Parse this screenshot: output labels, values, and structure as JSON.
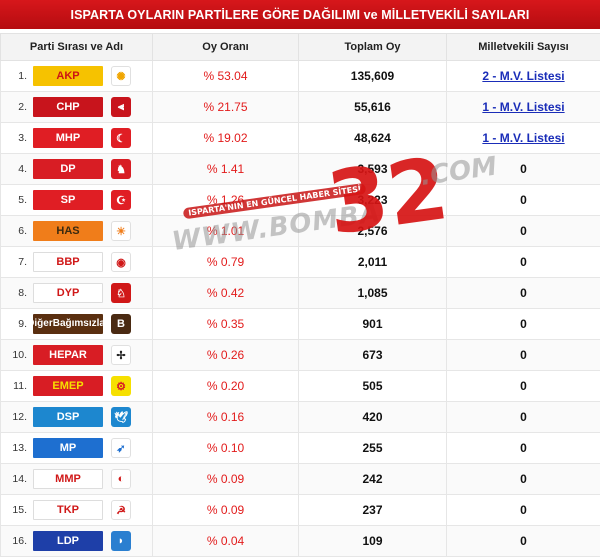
{
  "title": "ISPARTA OYLARIN PARTİLERE GÖRE DAĞILIMI ve MİLLETVEKİLİ SAYILARI",
  "headers": {
    "party": "Parti Sırası ve Adı",
    "rate": "Oy Oranı",
    "total": "Toplam Oy",
    "mv": "Milletvekili Sayısı"
  },
  "watermark": {
    "site": "WWW.BOMBA",
    "number": "32",
    "com": ".COM",
    "tag": "ISPARTA'NIN EN GÜNCEL HABER SİTESİ"
  },
  "rows": [
    {
      "rank": "1.",
      "party": "AKP",
      "rate": "% 53.04",
      "total": "135,609",
      "mv": "2 - M.V. Listesi",
      "mv_link": true,
      "box_color": "#f6c200",
      "text_color": "#cc1414",
      "logo_icon": "lightbulb-icon",
      "logo_glyph": "✺",
      "logo_color": "#f0a500",
      "logo_bg": "#ffffff"
    },
    {
      "rank": "2.",
      "party": "CHP",
      "rate": "% 21.75",
      "total": "55,616",
      "mv": "1 - M.V. Listesi",
      "mv_link": true,
      "box_color": "#c8141c",
      "text_color": "#ffffff",
      "logo_icon": "six-arrows-icon",
      "logo_glyph": "⫷",
      "logo_color": "#ffffff",
      "logo_bg": "#c8141c"
    },
    {
      "rank": "3.",
      "party": "MHP",
      "rate": "% 19.02",
      "total": "48,624",
      "mv": "1 - M.V. Listesi",
      "mv_link": true,
      "box_color": "#e01e24",
      "text_color": "#ffffff",
      "logo_icon": "three-crescents-icon",
      "logo_glyph": "☾",
      "logo_color": "#ffffff",
      "logo_bg": "#e01e24"
    },
    {
      "rank": "4.",
      "party": "DP",
      "rate": "% 1.41",
      "total": "3,593",
      "mv": "0",
      "mv_link": false,
      "box_color": "#d81d24",
      "text_color": "#ffffff",
      "logo_icon": "horse-icon",
      "logo_glyph": "♞",
      "logo_color": "#ffffff",
      "logo_bg": "#d81d24"
    },
    {
      "rank": "5.",
      "party": "SP",
      "rate": "% 1.26",
      "total": "3,223",
      "mv": "0",
      "mv_link": false,
      "box_color": "#e01e24",
      "text_color": "#ffffff",
      "logo_icon": "crescent-star-icon",
      "logo_glyph": "☪",
      "logo_color": "#ffffff",
      "logo_bg": "#e01e24"
    },
    {
      "rank": "6.",
      "party": "HAS",
      "rate": "% 1.01",
      "total": "2,576",
      "mv": "0",
      "mv_link": false,
      "box_color": "#f07d1a",
      "text_color": "#3a2a10",
      "logo_icon": "sun-icon",
      "logo_glyph": "☀",
      "logo_color": "#f07d1a",
      "logo_bg": "#ffffff"
    },
    {
      "rank": "7.",
      "party": "BBP",
      "rate": "% 0.79",
      "total": "2,011",
      "mv": "0",
      "mv_link": false,
      "box_color": "#ffffff",
      "text_color": "#d01818",
      "logo_icon": "bbp-emblem-icon",
      "logo_glyph": "◉",
      "logo_color": "#d01818",
      "logo_bg": "#ffffff"
    },
    {
      "rank": "8.",
      "party": "DYP",
      "rate": "% 0.42",
      "total": "1,085",
      "mv": "0",
      "mv_link": false,
      "box_color": "#ffffff",
      "text_color": "#d01818",
      "logo_icon": "horse-circle-icon",
      "logo_glyph": "♘",
      "logo_color": "#ffffff",
      "logo_bg": "#d01818"
    },
    {
      "rank": "9.",
      "party": "Diğer Bağımsızlar",
      "rate": "% 0.35",
      "total": "901",
      "mv": "0",
      "mv_link": false,
      "box_color": "#5a2f10",
      "text_color": "#ffffff",
      "logo_icon": "independent-b-icon",
      "logo_glyph": "B",
      "logo_color": "#ffffff",
      "logo_bg": "#4a2a12"
    },
    {
      "rank": "10.",
      "party": "HEPAR",
      "rate": "% 0.26",
      "total": "673",
      "mv": "0",
      "mv_link": false,
      "box_color": "#d81d24",
      "text_color": "#ffffff",
      "logo_icon": "eagle-icon",
      "logo_glyph": "✢",
      "logo_color": "#222222",
      "logo_bg": "#ffffff"
    },
    {
      "rank": "11.",
      "party": "EMEP",
      "rate": "% 0.20",
      "total": "505",
      "mv": "0",
      "mv_link": false,
      "box_color": "#d81d24",
      "text_color": "#f6e000",
      "logo_icon": "emep-gear-icon",
      "logo_glyph": "⚙",
      "logo_color": "#d81d24",
      "logo_bg": "#f6e000"
    },
    {
      "rank": "12.",
      "party": "DSP",
      "rate": "% 0.16",
      "total": "420",
      "mv": "0",
      "mv_link": false,
      "box_color": "#1d87cf",
      "text_color": "#ffffff",
      "logo_icon": "dove-icon",
      "logo_glyph": "🕊",
      "logo_color": "#ffffff",
      "logo_bg": "#1d87cf"
    },
    {
      "rank": "13.",
      "party": "MP",
      "rate": "% 0.10",
      "total": "255",
      "mv": "0",
      "mv_link": false,
      "box_color": "#1e6fd0",
      "text_color": "#ffffff",
      "logo_icon": "bird-icon",
      "logo_glyph": "➶",
      "logo_color": "#1e6fd0",
      "logo_bg": "#ffffff"
    },
    {
      "rank": "14.",
      "party": "MMP",
      "rate": "% 0.09",
      "total": "242",
      "mv": "0",
      "mv_link": false,
      "box_color": "#ffffff",
      "text_color": "#d01818",
      "logo_icon": "crescent-globe-icon",
      "logo_glyph": "◐",
      "logo_color": "#d01818",
      "logo_bg": "#ffffff"
    },
    {
      "rank": "15.",
      "party": "TKP",
      "rate": "% 0.09",
      "total": "237",
      "mv": "0",
      "mv_link": false,
      "box_color": "#ffffff",
      "text_color": "#d01818",
      "logo_icon": "hammer-sickle-icon",
      "logo_glyph": "☭",
      "logo_color": "#d01818",
      "logo_bg": "#ffffff"
    },
    {
      "rank": "16.",
      "party": "LDP",
      "rate": "% 0.04",
      "total": "109",
      "mv": "0",
      "mv_link": false,
      "box_color": "#1e3fa8",
      "text_color": "#ffffff",
      "logo_icon": "dolphin-icon",
      "logo_glyph": "◗",
      "logo_color": "#ffffff",
      "logo_bg": "#2a7fd0"
    }
  ]
}
